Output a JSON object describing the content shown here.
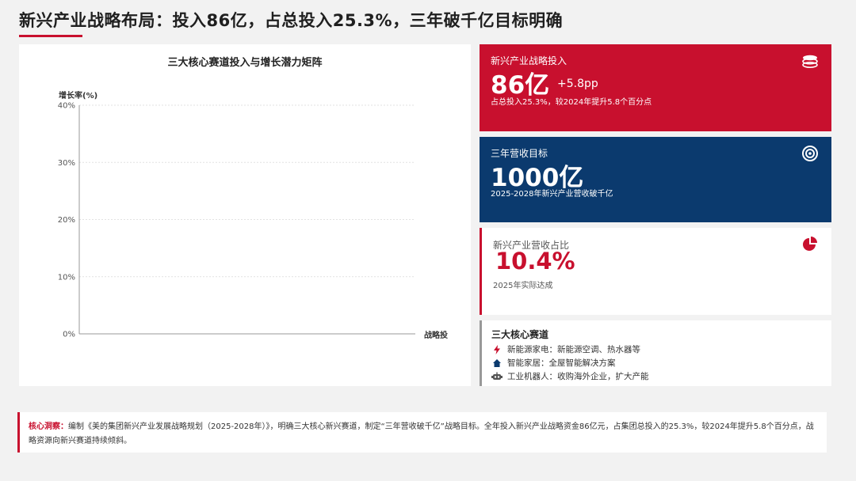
{
  "header": {
    "title": "新兴产业战略布局：投入86亿，占总投入25.3%，三年破千亿目标明确"
  },
  "chart_data": {
    "type": "scatter",
    "title": "三大核心赛道投入与增长潜力矩阵",
    "ylabel": "增长率(%)",
    "xlabel": "战略投",
    "ylim": [
      0,
      40
    ],
    "yticks": [
      "0%",
      "10%",
      "20%",
      "30%",
      "40%"
    ],
    "grid": true,
    "series": []
  },
  "cards": {
    "investment": {
      "label": "新兴产业战略投入",
      "value": "86亿",
      "delta": "+5.8pp",
      "sub": "占总投入25.3%，较2024年提升5.8个百分点",
      "icon": "coins-icon"
    },
    "target": {
      "label": "三年营收目标",
      "value": "1000亿",
      "sub": "2025-2028年新兴产业营收破千亿",
      "icon": "target-icon"
    },
    "share": {
      "label": "新兴产业营收占比",
      "value": "10.4%",
      "sub": "2025年实际达成",
      "icon": "pie-chart-icon"
    },
    "tracks": {
      "title": "三大核心赛道",
      "items": [
        {
          "name": "新能源家电：",
          "desc": "新能源空调、热水器等",
          "icon": "bolt-icon"
        },
        {
          "name": "智能家居：",
          "desc": "全屋智能解决方案",
          "icon": "home-icon"
        },
        {
          "name": "工业机器人：",
          "desc": "收购海外企业，扩大产能",
          "icon": "robot-icon"
        }
      ]
    }
  },
  "insight": {
    "label": "核心洞察：",
    "text": "编制《美的集团新兴产业发展战略规划（2025-2028年）》，明确三大核心新兴赛道，制定“三年营收破千亿”战略目标。全年投入新兴产业战略资金86亿元，占集团总投入的25.3%，较2024年提升5.8个百分点，战略资源向新兴赛道持续倾斜。"
  },
  "colors": {
    "accent_red": "#c8102e",
    "navy": "#0b3a6e",
    "background": "#f2f2f2"
  }
}
